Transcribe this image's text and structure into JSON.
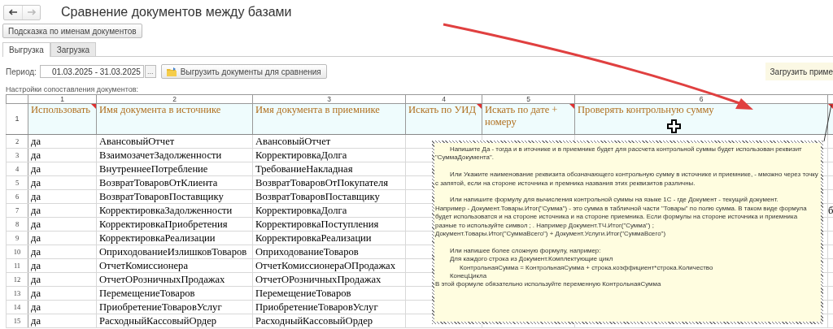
{
  "window": {
    "title": "Сравнение документов между базами"
  },
  "nav": [
    {
      "kind": "back",
      "disabled": false
    },
    {
      "kind": "forward",
      "disabled": true
    }
  ],
  "hint_button": "Подсказка по именам документов",
  "tabs": [
    {
      "label": "Выгрузка",
      "selected": true
    },
    {
      "label": "Загрузка",
      "selected": false
    }
  ],
  "period": {
    "label": "Период:",
    "value": "01.03.2025 - 31.03.2025",
    "picker": "..."
  },
  "export_button": "Выгрузить документы для сравнения",
  "import_button": "Загрузить приме",
  "grid": {
    "caption": "Настройки сопоставления документов:",
    "header_row_number": "1",
    "columns": [
      {
        "number": "1",
        "header": "Использовать",
        "comment_mark": true
      },
      {
        "number": "2",
        "header": "Имя документа в источнике",
        "comment_mark": false
      },
      {
        "number": "3",
        "header": "Имя документа в приемнике",
        "comment_mark": false
      },
      {
        "number": "4",
        "header": "Искать по УИД",
        "comment_mark": true
      },
      {
        "number": "5",
        "header": "Искать по дате + номеру",
        "comment_mark": true
      },
      {
        "number": "6",
        "header": "Проверять контрольную сумму",
        "comment_mark": false
      },
      {
        "comment_mark": true
      }
    ],
    "rows": [
      {
        "number": "2",
        "cells": [
          "да",
          "АвансовыйОтчет",
          "АвансовыйОтчет"
        ]
      },
      {
        "number": "3",
        "cells": [
          "да",
          "ВзаимозачетЗадолженности",
          "КорректировкаДолга"
        ]
      },
      {
        "number": "4",
        "cells": [
          "да",
          "ВнутреннееПотребление",
          "ТребованиеНакладная"
        ]
      },
      {
        "number": "5",
        "cells": [
          "да",
          "ВозвратТоваровОтКлиента",
          "ВозвратТоваровОтПокупателя"
        ]
      },
      {
        "number": "6",
        "cells": [
          "да",
          "ВозвратТоваровПоставщику",
          "ВозвратТоваровПоставщику"
        ]
      },
      {
        "number": "7",
        "cells": [
          "да",
          "КорректировкаЗадолженности",
          "КорректировкаДолга"
        ],
        "column_7": "б"
      },
      {
        "number": "8",
        "cells": [
          "да",
          "КорректировкаПриобретения",
          "КорректировкаПоступления"
        ]
      },
      {
        "number": "9",
        "cells": [
          "да",
          "КорректировкаРеализации",
          "КорректировкаРеализации"
        ]
      },
      {
        "number": "10",
        "cells": [
          "да",
          "ОприходованиеИзлишковТоваров",
          "ОприходованиеТоваров"
        ]
      },
      {
        "number": "11",
        "cells": [
          "да",
          "ОтчетКомиссионера",
          "ОтчетКомиссионераОПродажах"
        ]
      },
      {
        "number": "12",
        "cells": [
          "да",
          "ОтчетОРозничныхПродажах",
          "ОтчетОРозничныхПродажах"
        ]
      },
      {
        "number": "13",
        "cells": [
          "да",
          "ПеремещениеТоваров",
          "ПеремещениеТоваров"
        ]
      },
      {
        "number": "14",
        "cells": [
          "да",
          "ПриобретениеТоваровУслуг",
          "ПриобретениеТоваровУслуг"
        ]
      },
      {
        "number": "15",
        "cells": [
          "да",
          "РасходныйКассовыйОрдер",
          "РасходныйКассовыйОрдер"
        ]
      }
    ]
  },
  "comment": {
    "items": [
      {
        "kind": "paragraph",
        "text": "Напишите Да - тогда и в иточнике и в приемнике будет для рассчета контрольной суммы будет использован реквизит \"СуммаДокумента\"."
      },
      {
        "kind": "paragraph",
        "text": "Или Укажите наименование реквизита обозначающего контрольную сумму в источнике и приемнике, - мможно через точку с запятой, если на стороне источника и премника названия этих реквизитов различны."
      },
      {
        "kind": "line",
        "text": "Или напишите формулу для вычисления контрольной суммы на языке 1С - где Документ - текущий документ."
      },
      {
        "kind": "plain",
        "text": "Например  -  Документ.Товары.Итог(\"Сумма\") - это сумма в табличной части \"Товары\" по полю сумма. В таком виде формула будет использоватся и на стороне источника и на стороне приемника. Если формулы на стороне источника и приемника разные то используйте символ ; . Например  Документ.ТЧ.Итог(\"Сумма\") ;"
      },
      {
        "kind": "plain-gap",
        "text": "Документ.Товары.Итог(\"СуммаВсего\")  + Документ.Услуги.Итог(\"СуммаВсего\")"
      },
      {
        "kind": "line",
        "text": "Или напишее более сложную формулу, например:"
      },
      {
        "kind": "line",
        "text": "Для каждого строка из Документ.Комплектующие цикл"
      },
      {
        "kind": "nested",
        "text": "КонтрольнаяСумма = КонтрольнаяСумма +  строка.коэффициент*строка.Количество"
      },
      {
        "kind": "line",
        "text": "КонецЦикла"
      },
      {
        "kind": "plain",
        "text": "В этой формуле обязательно используйте переменную КонтрольнаяСумма"
      }
    ]
  }
}
